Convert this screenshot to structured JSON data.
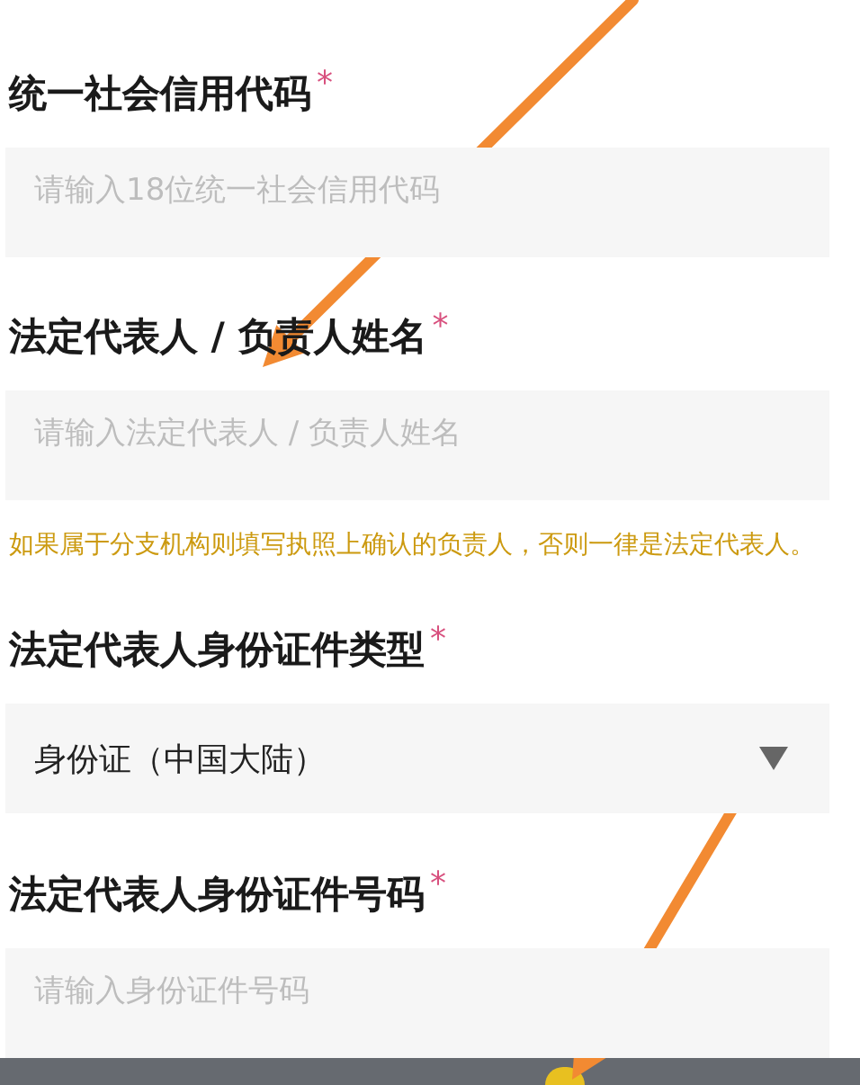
{
  "fields": [
    {
      "kind": "input",
      "label": "统一社会信用代码",
      "required_mark": "*",
      "placeholder": "请输入18位统一社会信用代码"
    },
    {
      "kind": "input",
      "label": "法定代表人 / 负责人姓名",
      "required_mark": "*",
      "placeholder": "请输入法定代表人 / 负责人姓名",
      "note": "如果属于分支机构则填写执照上确认的负责人，否则一律是法定代表人。"
    },
    {
      "kind": "select",
      "label": "法定代表人身份证件类型",
      "required_mark": "*",
      "value": "身份证（中国大陆）"
    },
    {
      "kind": "input",
      "label": "法定代表人身份证件号码",
      "required_mark": "*",
      "placeholder": "请输入身份证件号码"
    }
  ],
  "annotations": [
    {
      "kind": "arrow"
    },
    {
      "kind": "arrow"
    }
  ]
}
